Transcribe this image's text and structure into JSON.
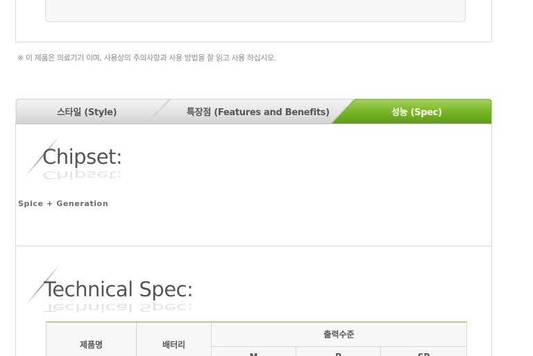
{
  "notice": "※ 이 제품은 의료기기 이며, 사용상의 주의사항과 사용 방법을 잘 읽고 사용 하십시오.",
  "tabs": [
    {
      "label": "스타일 (Style)",
      "active": false
    },
    {
      "label": "특장점 (Features and Benefits)",
      "active": false
    },
    {
      "label": "성능 (Spec)",
      "active": true
    }
  ],
  "chipset": {
    "heading": "Chipset:",
    "value": "Spice + Generation"
  },
  "technical_spec": {
    "heading": "Technical Spec:",
    "table": {
      "col_product": "제품명",
      "col_battery": "배터리",
      "col_output": "출력수준",
      "output_levels": [
        "M",
        "P",
        "SP"
      ]
    }
  },
  "colors": {
    "active_tab": "#7bb728",
    "inactive_tab": "#e6e6e6",
    "table_accent": "#b9cf8a"
  }
}
